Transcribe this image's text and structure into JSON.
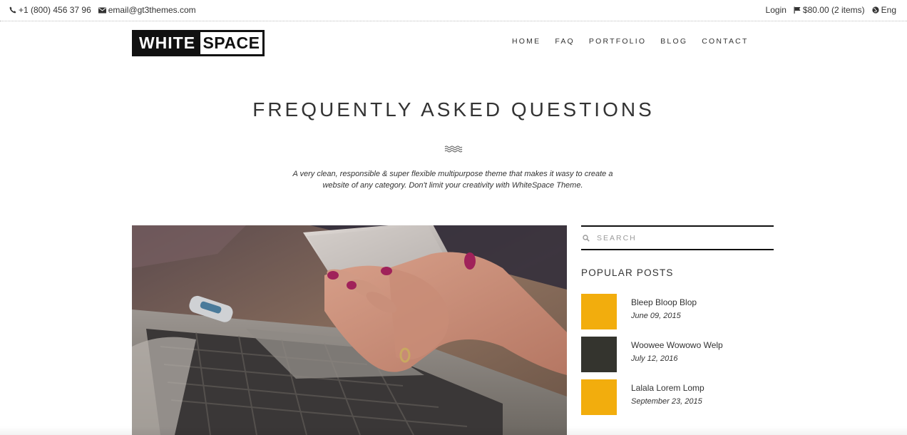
{
  "topbar": {
    "phone": "+1 (800) 456 37 96",
    "email": "email@gt3themes.com",
    "login": "Login",
    "cart": "$80.00 (2 items)",
    "language": "Eng"
  },
  "logo": {
    "part1": "WHITE",
    "part2": "SPACE"
  },
  "nav": {
    "items": [
      {
        "label": "HOME"
      },
      {
        "label": "FAQ"
      },
      {
        "label": "PORTFOLIO"
      },
      {
        "label": "BLOG"
      },
      {
        "label": "CONTACT"
      }
    ]
  },
  "hero": {
    "title": "FREQUENTLY ASKED QUESTIONS",
    "subtitle_line1": "A very clean, responsible & super flexible multipurpose theme that makes it wasy to create a",
    "subtitle_line2": "website of any category. Don't limit your creativity with WhiteSpace Theme."
  },
  "sidebar": {
    "search_placeholder": "SEARCH",
    "popular_title": "POPULAR POSTS",
    "posts": [
      {
        "title": "Bleep Bloop Blop",
        "date": "June 09, 2015",
        "color": "#f2ad0d"
      },
      {
        "title": "Woowee Wowowo Welp",
        "date": "July 12, 2016",
        "color": "#34342e"
      },
      {
        "title": "Lalala Lorem Lomp",
        "date": "September 23, 2015",
        "color": "#f2ad0d"
      }
    ]
  },
  "colors": {
    "accent": "#f2ad0d",
    "dark": "#34342e",
    "text": "#333333"
  },
  "icons": [
    "phone-icon",
    "envelope-icon",
    "flag-icon",
    "globe-icon",
    "search-icon",
    "wave-divider-icon"
  ]
}
